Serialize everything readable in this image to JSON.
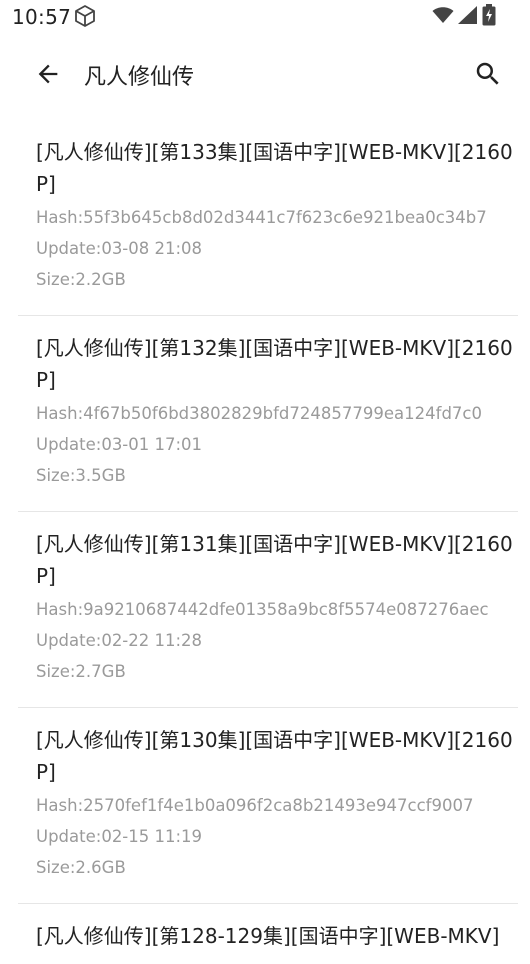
{
  "status_bar": {
    "time": "10:57"
  },
  "app_bar": {
    "title": "凡人修仙传"
  },
  "results": [
    {
      "title": "[凡人修仙传][第133集][国语中字][WEB-MKV][2160P]",
      "hash": "Hash:55f3b645cb8d02d3441c7f623c6e921bea0c34b7",
      "update": "Update:03-08 21:08",
      "size": "Size:2.2GB"
    },
    {
      "title": "[凡人修仙传][第132集][国语中字][WEB-MKV][2160P]",
      "hash": "Hash:4f67b50f6bd3802829bfd724857799ea124fd7c0",
      "update": "Update:03-01 17:01",
      "size": "Size:3.5GB"
    },
    {
      "title": "[凡人修仙传][第131集][国语中字][WEB-MKV][2160P]",
      "hash": "Hash:9a9210687442dfe01358a9bc8f5574e087276aec",
      "update": "Update:02-22 11:28",
      "size": "Size:2.7GB"
    },
    {
      "title": "[凡人修仙传][第130集][国语中字][WEB-MKV][2160P]",
      "hash": "Hash:2570fef1f4e1b0a096f2ca8b21493e947ccf9007",
      "update": "Update:02-15 11:19",
      "size": "Size:2.6GB"
    },
    {
      "title": "[凡人修仙传][第128-129集][国语中字][WEB-MKV]"
    }
  ],
  "icons": {
    "back": "arrow-back-icon",
    "search": "search-icon",
    "cube": "cube-icon",
    "wifi": "wifi-icon",
    "signal": "signal-icon",
    "battery": "battery-charging-icon"
  }
}
